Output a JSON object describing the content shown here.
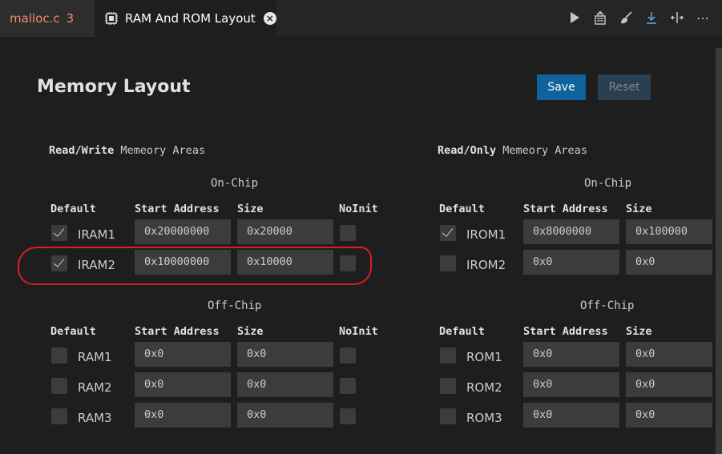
{
  "tabs": [
    {
      "label": "malloc.c",
      "badge": "3"
    },
    {
      "label": "RAM And ROM Layout",
      "close": "×"
    }
  ],
  "toolbar_icons": [
    "play-icon",
    "build-icon",
    "clean-icon",
    "download-icon",
    "split-icon",
    "more-icon"
  ],
  "header": {
    "title": "Memory Layout",
    "save_label": "Save",
    "reset_label": "Reset"
  },
  "rw": {
    "title_bold": "Read/Write",
    "title_rest": " Memeory Areas",
    "onchip_title": "On-Chip",
    "offchip_title": "Off-Chip",
    "columns": {
      "default": "Default",
      "start": "Start Address",
      "size": "Size",
      "noinit": "NoInit"
    },
    "onchip": [
      {
        "name": "IRAM1",
        "checked": true,
        "start": "0x20000000",
        "size": "0x20000",
        "noinit": false
      },
      {
        "name": "IRAM2",
        "checked": true,
        "start": "0x10000000",
        "size": "0x10000",
        "noinit": false
      }
    ],
    "offchip": [
      {
        "name": "RAM1",
        "checked": false,
        "start": "0x0",
        "size": "0x0",
        "noinit": false
      },
      {
        "name": "RAM2",
        "checked": false,
        "start": "0x0",
        "size": "0x0",
        "noinit": false
      },
      {
        "name": "RAM3",
        "checked": false,
        "start": "0x0",
        "size": "0x0",
        "noinit": false
      }
    ]
  },
  "ro": {
    "title_bold": "Read/Only",
    "title_rest": " Memeory Areas",
    "onchip_title": "On-Chip",
    "offchip_title": "Off-Chip",
    "columns": {
      "default": "Default",
      "start": "Start Address",
      "size": "Size"
    },
    "onchip": [
      {
        "name": "IROM1",
        "checked": true,
        "start": "0x8000000",
        "size": "0x100000"
      },
      {
        "name": "IROM2",
        "checked": false,
        "start": "0x0",
        "size": "0x0"
      }
    ],
    "offchip": [
      {
        "name": "ROM1",
        "checked": false,
        "start": "0x0",
        "size": "0x0"
      },
      {
        "name": "ROM2",
        "checked": false,
        "start": "0x0",
        "size": "0x0"
      },
      {
        "name": "ROM3",
        "checked": false,
        "start": "0x0",
        "size": "0x0"
      }
    ]
  },
  "colors": {
    "accent": "#0e639c",
    "annotation": "#d81e1e",
    "error_tab": "#f48771"
  }
}
